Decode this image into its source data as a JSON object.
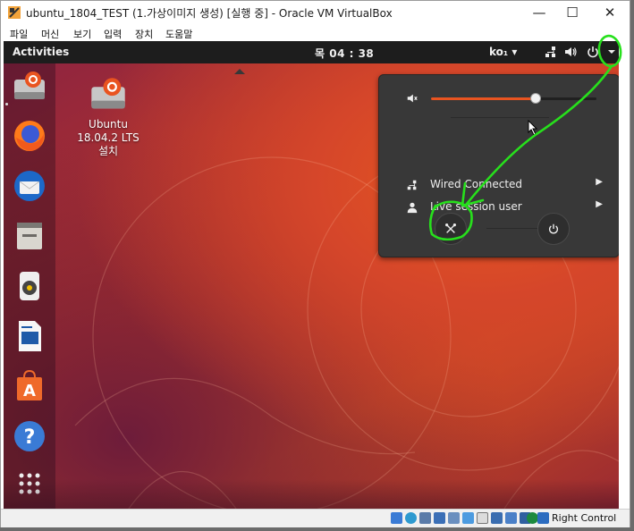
{
  "window": {
    "title": "ubuntu_1804_TEST (1.가상이미지 생성) [실행 중] - Oracle VM VirtualBox",
    "minimize": "—",
    "maximize": "☐",
    "close": "✕"
  },
  "menubar": [
    "파일",
    "머신",
    "보기",
    "입력",
    "장치",
    "도움말"
  ],
  "topbar": {
    "activities": "Activities",
    "clock": "목 04 : 38",
    "keyboard": "ko₁ ▾"
  },
  "desktop_icon": {
    "line1": "Ubuntu",
    "line2": "18.04.2 LTS",
    "line3": "설치"
  },
  "system_menu": {
    "volume_percent": 63,
    "wired": "Wired Connected",
    "user": "Live session user",
    "arrow": "▶"
  },
  "statusbar": {
    "host_key": "Right Control"
  },
  "colors": {
    "accent": "#e95420",
    "annotation": "#27e01c",
    "topbar": "#1d1d1d",
    "popup": "#383838"
  },
  "icons": [
    "ubuntu-install-icon",
    "firefox-icon",
    "thunderbird-icon",
    "files-icon",
    "rhythmbox-icon",
    "writer-icon",
    "software-icon",
    "help-icon",
    "app-grid-icon",
    "speaker-icon",
    "network-icon",
    "power-icon",
    "settings-icon"
  ]
}
